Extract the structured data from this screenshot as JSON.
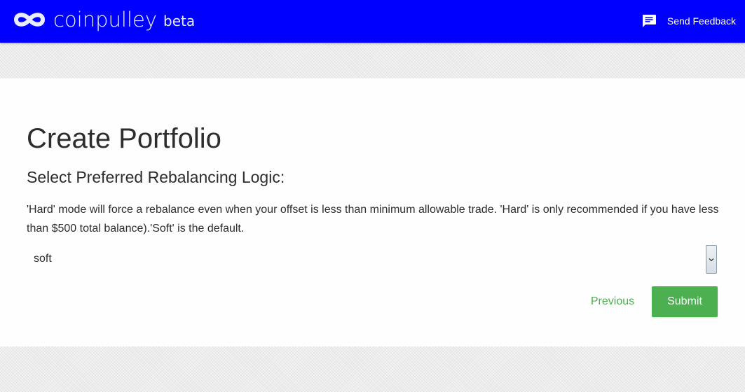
{
  "navbar": {
    "brand_name": "coinpulley",
    "brand_tag": "beta",
    "feedback_label": "Send Feedback",
    "feedback_icon": "feedback-chat-icon",
    "background_color": "#0000ff"
  },
  "main": {
    "title": "Create Portfolio",
    "section_heading": "Select Preferred Rebalancing Logic:",
    "description": "'Hard' mode will force a rebalance even when your offset is less than minimum allowable trade. 'Hard' is only recommended if you have less than $500 total balance).'Soft' is the default.",
    "rebalancing_select": {
      "selected_value": "soft"
    },
    "buttons": {
      "previous_label": "Previous",
      "submit_label": "Submit"
    },
    "accent_color": "#4caf50"
  }
}
